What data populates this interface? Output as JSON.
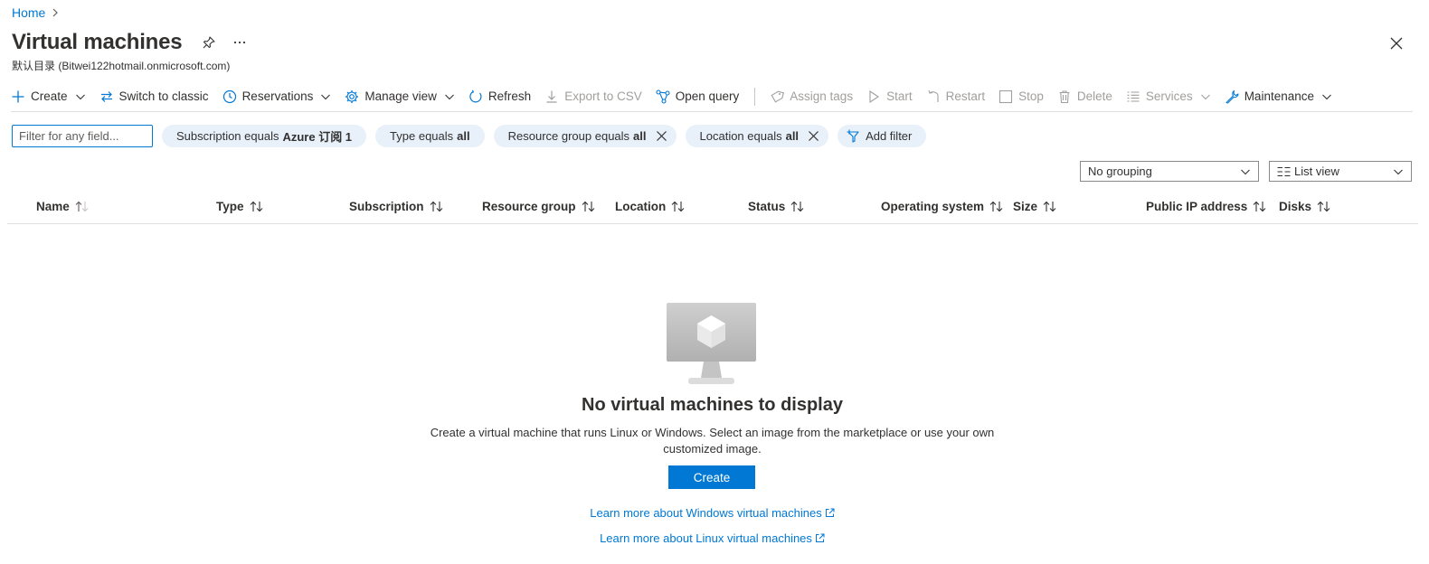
{
  "breadcrumb": {
    "home": "Home"
  },
  "header": {
    "title": "Virtual machines",
    "subtitle": "默认目录 (Bitwei122hotmail.onmicrosoft.com)"
  },
  "toolbar": {
    "create": "Create",
    "switch_classic": "Switch to classic",
    "reservations": "Reservations",
    "manage_view": "Manage view",
    "refresh": "Refresh",
    "export_csv": "Export to CSV",
    "open_query": "Open query",
    "assign_tags": "Assign tags",
    "start": "Start",
    "restart": "Restart",
    "stop": "Stop",
    "delete": "Delete",
    "services": "Services",
    "maintenance": "Maintenance"
  },
  "filters": {
    "placeholder": "Filter for any field...",
    "pills": [
      {
        "label": "Subscription equals",
        "value": "Azure 订阅 1"
      },
      {
        "label": "Type equals",
        "value": "all"
      },
      {
        "label": "Resource group equals",
        "value": "all"
      },
      {
        "label": "Location equals",
        "value": "all"
      }
    ],
    "add_filter": "Add filter"
  },
  "grouping": {
    "selected": "No grouping"
  },
  "view": {
    "selected": "List view"
  },
  "columns": [
    "Name",
    "Type",
    "Subscription",
    "Resource group",
    "Location",
    "Status",
    "Operating system",
    "Size",
    "Public IP address",
    "Disks"
  ],
  "empty": {
    "title": "No virtual machines to display",
    "description": "Create a virtual machine that runs Linux or Windows. Select an image from the marketplace or use your own customized image.",
    "create_button": "Create",
    "learn_windows": "Learn more about Windows virtual machines",
    "learn_linux": "Learn more about Linux virtual machines"
  },
  "colors": {
    "accent": "#0078d4",
    "pill_bg": "#e8f0fa",
    "disabled": "#a19f9d"
  }
}
